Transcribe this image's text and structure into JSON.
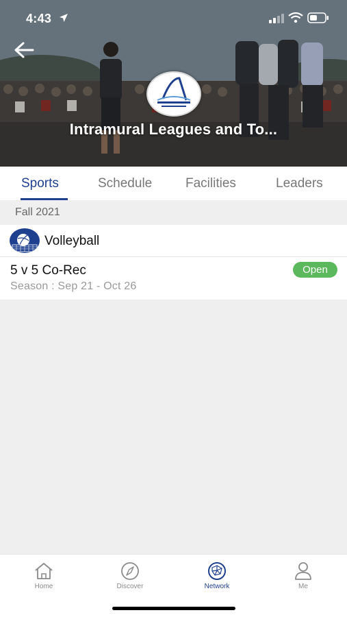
{
  "status_bar": {
    "time": "4:43"
  },
  "header": {
    "title": "Intramural Leagues and To..."
  },
  "tabs": [
    {
      "label": "Sports"
    },
    {
      "label": "Schedule"
    },
    {
      "label": "Facilities"
    },
    {
      "label": "Leaders"
    }
  ],
  "active_tab": "Sports",
  "section": {
    "label": "Fall 2021",
    "sport": {
      "name": "Volleyball",
      "icon": "volleyball-icon",
      "leagues": [
        {
          "name": "5 v 5 Co-Rec",
          "season": "Season : Sep 21 - Oct 26",
          "status": "Open"
        }
      ]
    }
  },
  "bottom_nav": [
    {
      "label": "Home",
      "icon": "home-icon"
    },
    {
      "label": "Discover",
      "icon": "compass-icon"
    },
    {
      "label": "Network",
      "icon": "network-icon"
    },
    {
      "label": "Me",
      "icon": "person-icon"
    }
  ],
  "active_nav": "Network",
  "colors": {
    "accent": "#1f3f8f",
    "open_badge": "#5cb85c",
    "section_bg": "#efefef",
    "inactive_text": "#777777"
  }
}
